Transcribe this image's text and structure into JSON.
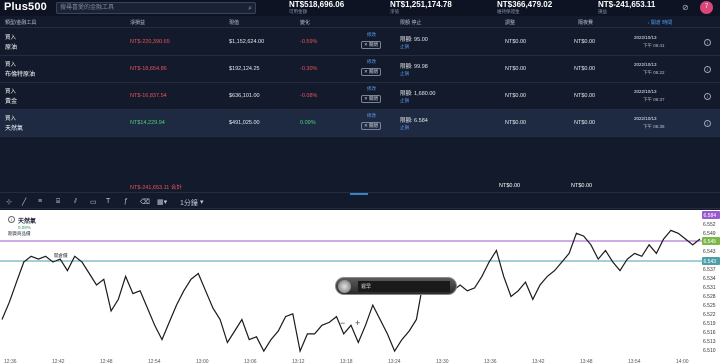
{
  "app": {
    "logo": "Plus500"
  },
  "search": {
    "placeholder": "搜尋喜愛的金融工具"
  },
  "account": [
    {
      "value": "NT$518,696.06",
      "label": "可用金額"
    },
    {
      "value": "NT$1,251,174.78",
      "label": "淨值"
    },
    {
      "value": "NT$366,479.02",
      "label": "維持保證金"
    },
    {
      "value": "NT$-241,653.11",
      "label": "損益"
    }
  ],
  "user": {
    "badge": "7"
  },
  "table": {
    "headers": {
      "instrument": "類型/金融工具",
      "pl": "淨損益",
      "price": "現值",
      "change": "變化",
      "limit_stop": "限額 停止",
      "adjust": "調整",
      "fee": "隔夜費",
      "time": "↓ 開倉 時間"
    },
    "rows": [
      {
        "type": "買入",
        "name": "原油",
        "pl": "NT$-220,390.65",
        "price": "$1,152,624.00",
        "change": "-0.59%",
        "edit": "修改",
        "close": "關閉",
        "limit": "限額: 95.00",
        "stop": "止損",
        "adjust": "NT$0.00",
        "fee": "NT$0.00",
        "date": "2022/10/13",
        "time": "下午 06:41"
      },
      {
        "type": "買入",
        "name": "布倫特原油",
        "pl": "NT$-18,654.86",
        "price": "$192,124.25",
        "change": "-0.30%",
        "edit": "修改",
        "close": "關閉",
        "limit": "限額: 99.98",
        "stop": "止損",
        "adjust": "NT$0.00",
        "fee": "NT$0.00",
        "date": "2022/10/13",
        "time": "下午 05:22"
      },
      {
        "type": "買入",
        "name": "黃金",
        "pl": "NT$-16,837.54",
        "price": "$636,101.00",
        "change": "-0.08%",
        "edit": "修改",
        "close": "關閉",
        "limit": "限額: 1,680.00",
        "stop": "止損",
        "adjust": "NT$0.00",
        "fee": "NT$0.00",
        "date": "2022/10/13",
        "time": "下午 06:37"
      },
      {
        "type": "買入",
        "name": "天然氣",
        "pl": "NT$14,229.94",
        "price": "$491,025.00",
        "change": "0.09%",
        "edit": "修改",
        "close": "關閉",
        "limit": "限額: 6.584",
        "stop": "止損",
        "adjust": "NT$0.00",
        "fee": "NT$0.00",
        "date": "2022/10/13",
        "time": "下午 06:38"
      }
    ],
    "totals": {
      "pl": "NT$-241,653.11 合計",
      "adjust": "NT$0.00",
      "fee": "NT$0.00"
    }
  },
  "chart_toolbar": {
    "interval": "1分鐘"
  },
  "chart": {
    "instrument": "天然氣",
    "change": "0.09%",
    "sub": "期貨商品價",
    "marker": "開倉價",
    "popup_text": "遲早",
    "zoom_out": "−",
    "zoom_in": "+",
    "colors": {
      "line": "#1a1a1a",
      "limit": "#9b59d0",
      "entry": "#4c9fa8"
    }
  },
  "chart_data": {
    "type": "line",
    "y_ticks": [
      "6.584",
      "6.552",
      "6.549",
      "6.546",
      "6.543",
      "6.540",
      "6.537",
      "6.534",
      "6.531",
      "6.528",
      "6.525",
      "6.522",
      "6.519",
      "6.516",
      "6.513",
      "6.510"
    ],
    "x_ticks": [
      "12:36",
      "12:42",
      "12:48",
      "12:54",
      "13:00",
      "13:06",
      "13:12",
      "13:18",
      "13:24",
      "13:30",
      "13:36",
      "13:42",
      "13:48",
      "13:54",
      "14:00"
    ],
    "ylim": [
      6.509,
      6.557
    ],
    "limit_level": "6.584",
    "current_level": "6.545",
    "entry_level": "6.543",
    "values": [
      6.521,
      6.527,
      6.534,
      6.541,
      6.543,
      6.542,
      6.543,
      6.541,
      6.542,
      6.538,
      6.543,
      6.541,
      6.537,
      6.533,
      6.535,
      6.524,
      6.528,
      6.536,
      6.53,
      6.531,
      6.525,
      6.519,
      6.514,
      6.52,
      6.526,
      6.531,
      6.535,
      6.537,
      6.531,
      6.525,
      6.521,
      6.513,
      6.517,
      6.521,
      6.514,
      6.515,
      6.51,
      6.514,
      6.517,
      6.522,
      6.523,
      6.51,
      6.516,
      6.516,
      6.519,
      6.52,
      6.522,
      6.516,
      6.519,
      6.513,
      6.519,
      6.526,
      6.521,
      6.516,
      6.51,
      6.514,
      6.517,
      6.521,
      6.535,
      6.535,
      6.535,
      6.534,
      6.531,
      6.533,
      6.531,
      6.532,
      6.536,
      6.541,
      6.545,
      6.536,
      6.529,
      6.531,
      6.534,
      6.528,
      6.533,
      6.536,
      6.538,
      6.541,
      6.544,
      6.551,
      6.55,
      6.547,
      6.542,
      6.545,
      6.541,
      6.538,
      6.542,
      6.544,
      6.543,
      6.547,
      6.544,
      6.549,
      6.552,
      6.551,
      6.549,
      6.547,
      6.549
    ]
  }
}
